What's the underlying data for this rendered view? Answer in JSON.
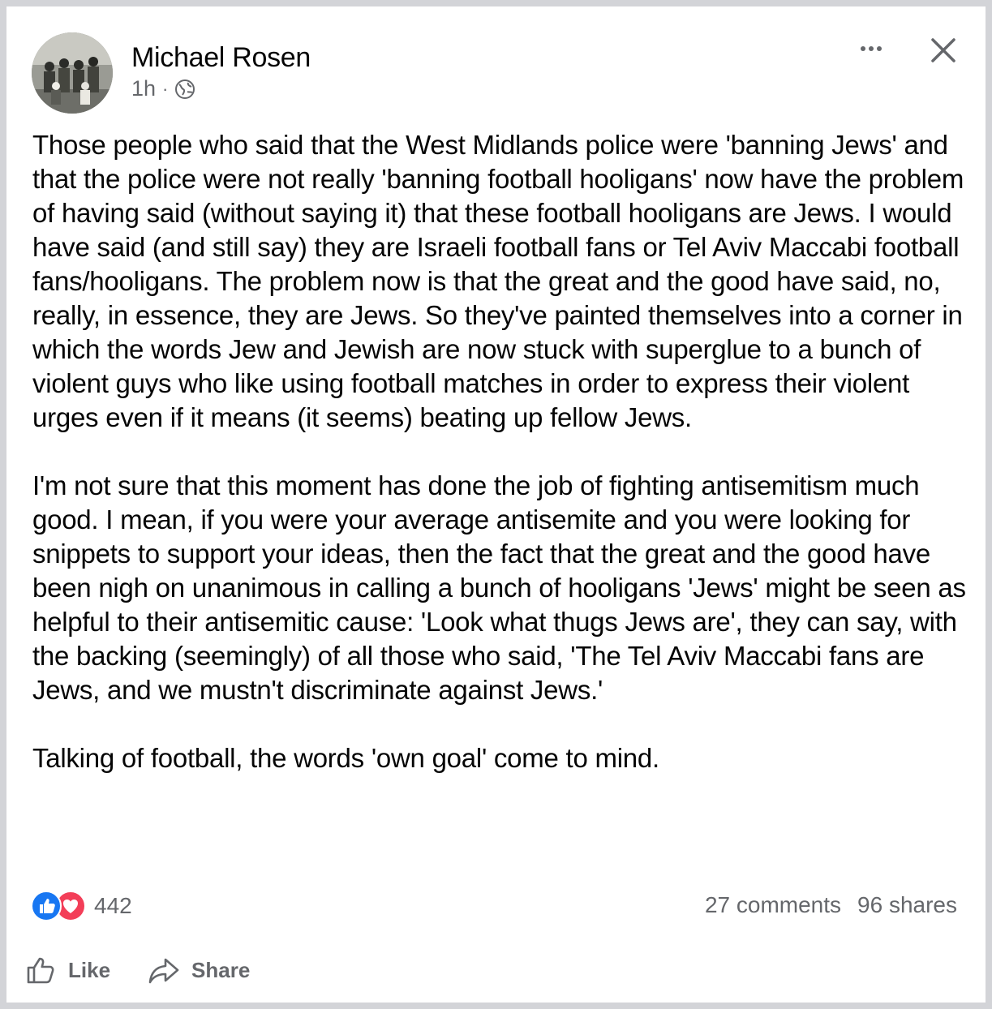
{
  "post": {
    "author": "Michael Rosen",
    "time": "1h",
    "separator": "·",
    "privacy_icon": "globe-icon",
    "avatar_icon": "avatar-photo",
    "paragraphs": [
      "Those people who said that the West Midlands police were 'banning Jews' and that the police were not really  'banning football hooligans' now have the problem of having said (without saying it) that these football hooligans are Jews. I would have said (and still say) they are Israeli football fans or Tel Aviv Maccabi football fans/hooligans. The problem now is that the great and the good have said, no, really, in essence, they are Jews.  So they've painted themselves into a corner in which the words Jew and Jewish are now stuck with superglue to a bunch of violent guys who like using football  matches in order to express their violent urges even if it means (it seems) beating up fellow Jews.",
      "I'm not sure that this moment has done the job of fighting antisemitism much good. I mean, if you were your average antisemite and you were looking for snippets to support your ideas, then the fact that the great and the good have been nigh on unanimous in calling a bunch of hooligans 'Jews' might be seen as helpful to their antisemitic cause: 'Look what thugs Jews are', they can say, with the backing (seemingly) of all those who said, 'The Tel Aviv Maccabi fans are Jews, and we mustn't discriminate against Jews.'",
      "Talking of football, the words 'own goal' come to mind."
    ]
  },
  "header_actions": {
    "more_icon": "more-horizontal-icon",
    "close_icon": "close-icon"
  },
  "reactions": {
    "icons": [
      "like-reaction-icon",
      "love-reaction-icon"
    ],
    "count": "442"
  },
  "stats": {
    "comments": "27 comments",
    "shares": "96 shares"
  },
  "actions": {
    "like_label": "Like",
    "share_label": "Share"
  },
  "colors": {
    "like_blue": "#1877f2",
    "love_red": "#f33e58",
    "secondary_text": "#65676b",
    "background": "#d3d4d8"
  }
}
